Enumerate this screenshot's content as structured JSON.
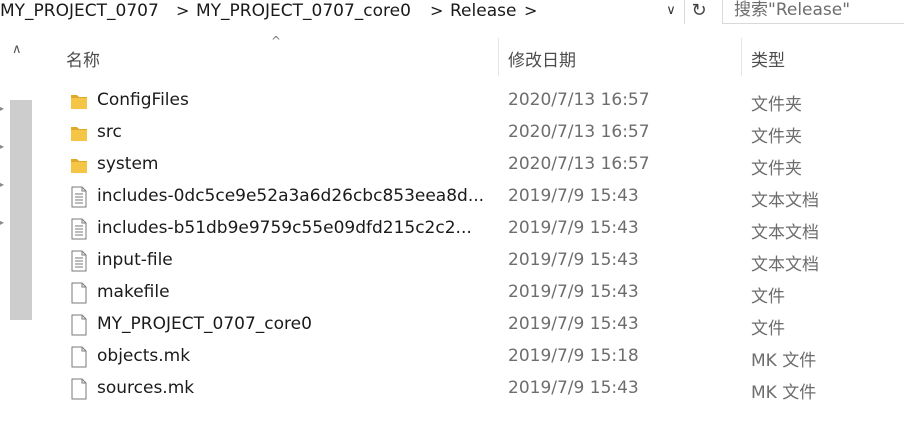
{
  "address": {
    "crumbs": [
      "MY_PROJECT_0707",
      "MY_PROJECT_0707_core0",
      "Release"
    ],
    "separator": ">",
    "dropdown_glyph": "∨",
    "refresh_glyph": "↻",
    "search_placeholder": "搜索\"Release\""
  },
  "nav": {
    "up_glyph": "∧",
    "expand_glyph": "▸"
  },
  "columns": {
    "name": "名称",
    "date": "修改日期",
    "type": "类型",
    "sort_glyph": "^"
  },
  "files": [
    {
      "name": "ConfigFiles",
      "date": "2020/7/13 16:57",
      "type": "文件夹",
      "icon": "folder-icon"
    },
    {
      "name": "src",
      "date": "2020/7/13 16:57",
      "type": "文件夹",
      "icon": "folder-icon"
    },
    {
      "name": "system",
      "date": "2020/7/13 16:57",
      "type": "文件夹",
      "icon": "folder-icon"
    },
    {
      "name": "includes-0dc5ce9e52a3a6d26cbc853eea8d...",
      "date": "2019/7/9 15:43",
      "type": "文本文档",
      "icon": "text-file-icon"
    },
    {
      "name": "includes-b51db9e9759c55e09dfd215c2c2...",
      "date": "2019/7/9 15:43",
      "type": "文本文档",
      "icon": "text-file-icon"
    },
    {
      "name": "input-file",
      "date": "2019/7/9 15:43",
      "type": "文本文档",
      "icon": "text-file-icon"
    },
    {
      "name": "makefile",
      "date": "2019/7/9 15:43",
      "type": "文件",
      "icon": "blank-file-icon"
    },
    {
      "name": "MY_PROJECT_0707_core0",
      "date": "2019/7/9 15:43",
      "type": "文件",
      "icon": "blank-file-icon"
    },
    {
      "name": "objects.mk",
      "date": "2019/7/9 15:18",
      "type": "MK 文件",
      "icon": "blank-file-icon"
    },
    {
      "name": "sources.mk",
      "date": "2019/7/9 15:43",
      "type": "MK 文件",
      "icon": "blank-file-icon"
    }
  ],
  "colors": {
    "folder": "#f5c645",
    "folder_dark": "#e0a92a",
    "scrollbar": "#cdcdcd"
  }
}
